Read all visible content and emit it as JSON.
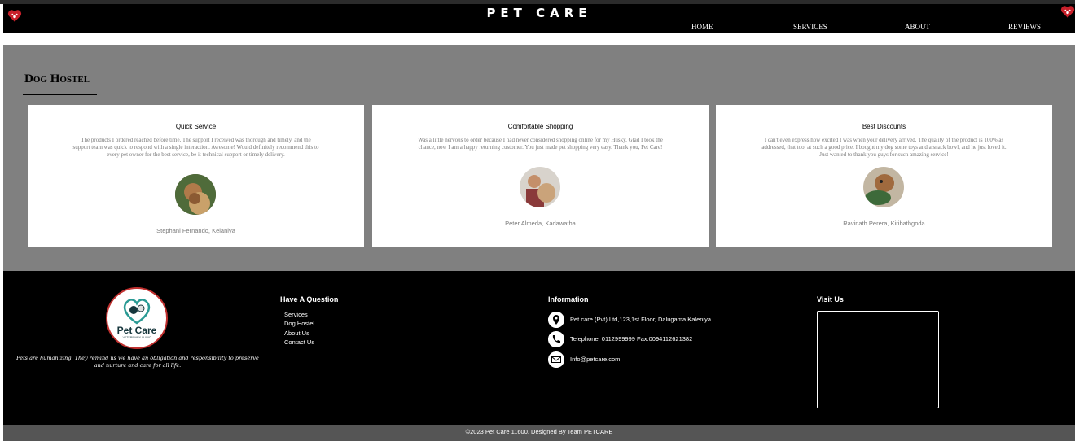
{
  "header": {
    "title": "PET CARE",
    "nav": [
      "HOME",
      "SERVICES",
      "ABOUT",
      "REVIEWS"
    ]
  },
  "section": {
    "title": "Dog Hostel"
  },
  "reviews": [
    {
      "title": "Quick Service",
      "text": "The products I ordered reached before time. The support I received was thorough and timely, and the support team was quick to respond with a single interaction. Awesome! Would definitely recommend this to every pet owner for the best service, be it technical support or timely delivery.",
      "author": "Stephani Fernando, Kelaniya"
    },
    {
      "title": "Comfortable Shopping",
      "text": "Was a little nervous to order because I had never considered shopping online for my Husky. Glad I took the chance, now I am a happy returning customer. You just made pet shopping very easy. Thank you, Pet Care!",
      "author": "Peter Almeda, Kadawatha"
    },
    {
      "title": "Best Discounts",
      "text": "I can't even express how excited I was when your delivery arrived. The quality of the product is 100% as addressed, that too, at such a good price. I bought my dog some toys and a snack bowl, and he just loved it. Just wanted to thank you guys for such amazing service!",
      "author": "Ravinath Perera, Kiribathgoda"
    }
  ],
  "footer": {
    "logo_text": "Pet Care",
    "logo_sub": "VETERINARY CLINIC",
    "tagline": "Pets are humanizing. They remind us we have an obligation and responsibility to preserve and nurture and care for all life.",
    "question_heading": "Have A Question",
    "links": [
      "Services",
      "Dog Hostel",
      "About Us",
      "Contact Us"
    ],
    "info_heading": "Information",
    "address": "Pet care (Pvt) Ltd,123,1st Floor, Dalugama,Kaleniya",
    "phone": "Telephone: 0112999999 Fax:0094112621382",
    "email": "Info@petcare.com",
    "visit_heading": "Visit Us"
  },
  "copyright": "©2023 Pet Care 11600. Designed By Team PETCARE",
  "colors": {
    "header_bg": "#000000",
    "section_bg": "#808080",
    "accent_red": "#c0302f"
  }
}
